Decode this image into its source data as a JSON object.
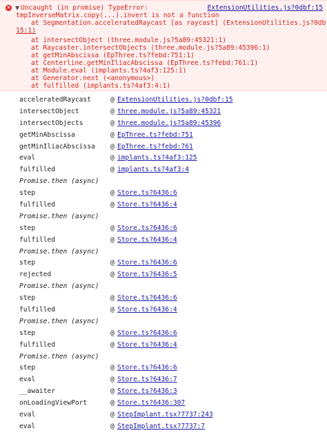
{
  "error": {
    "lines": [
      "Uncaught (in promise) TypeError:",
      "tmpInverseMatrix.copy(...).invert is not a function",
      "at Segmentation.acceleratedRaycast [as raycast] (ExtensionUtilities.js?0dbf:",
      "15:1)",
      "at intersectObject (three.module.js?5a89:45321:1)",
      "at Raycaster.intersectObjects (three.module.js?5a89:45396:1)",
      "at getMinAbscissa (EpThree.ts?febd:751:1)",
      "at Centerline.getMinIliacAbscissa (EpThree.ts?febd:761:1)",
      "at Module.eval (implants.ts?4af3:125:1)",
      "at Generator.next (<anonymous>)",
      "at fulfilled (implants.ts?4af3:4:1)"
    ],
    "source_link": "ExtensionUtilities.js?0dbf:15",
    "icon": "error-circle-icon",
    "toggle_icon": "triangle-down-icon"
  },
  "trace": [
    {
      "fn": "acceleratedRaycast",
      "loc": "ExtensionUtilities.js?0dbf:15"
    },
    {
      "fn": "intersectObject",
      "loc": "three.module.js?5a89:45321"
    },
    {
      "fn": "intersectObjects",
      "loc": "three.module.js?5a89:45396"
    },
    {
      "fn": "getMinAbscissa",
      "loc": "EpThree.ts?febd:751"
    },
    {
      "fn": "getMinIliacAbscissa",
      "loc": "EpThree.ts?febd:761"
    },
    {
      "fn": "eval",
      "loc": "implants.ts?4af3:125"
    },
    {
      "fn": "fulfilled",
      "loc": "implants.ts?4af3:4"
    },
    {
      "async": "Promise.then (async)"
    },
    {
      "fn": "step",
      "loc": "Store.ts?6436:6"
    },
    {
      "fn": "fulfilled",
      "loc": "Store.ts?6436:4"
    },
    {
      "async": "Promise.then (async)"
    },
    {
      "fn": "step",
      "loc": "Store.ts?6436:6"
    },
    {
      "fn": "fulfilled",
      "loc": "Store.ts?6436:4"
    },
    {
      "async": "Promise.then (async)"
    },
    {
      "fn": "step",
      "loc": "Store.ts?6436:6"
    },
    {
      "fn": "rejected",
      "loc": "Store.ts?6436:5"
    },
    {
      "async": "Promise.then (async)"
    },
    {
      "fn": "step",
      "loc": "Store.ts?6436:6"
    },
    {
      "fn": "fulfilled",
      "loc": "Store.ts?6436:4"
    },
    {
      "async": "Promise.then (async)"
    },
    {
      "fn": "step",
      "loc": "Store.ts?6436:6"
    },
    {
      "fn": "fulfilled",
      "loc": "Store.ts?6436:4"
    },
    {
      "async": "Promise.then (async)"
    },
    {
      "fn": "step",
      "loc": "Store.ts?6436:6"
    },
    {
      "fn": "eval",
      "loc": "Store.ts?6436:7"
    },
    {
      "fn": "__awaiter",
      "loc": "Store.ts?6436:3"
    },
    {
      "fn": "onLoadingViewPort",
      "loc": "Store.ts?6436:307"
    },
    {
      "fn": "eval",
      "loc": "StepImplant.tsx?7737:243"
    },
    {
      "fn": "eval",
      "loc": "StepImplant.tsx?7737:7"
    }
  ],
  "at_symbol": "@",
  "colors": {
    "error_bg": "#fff0f0",
    "error_text": "#d0281e",
    "link": "#1a1aa6"
  }
}
